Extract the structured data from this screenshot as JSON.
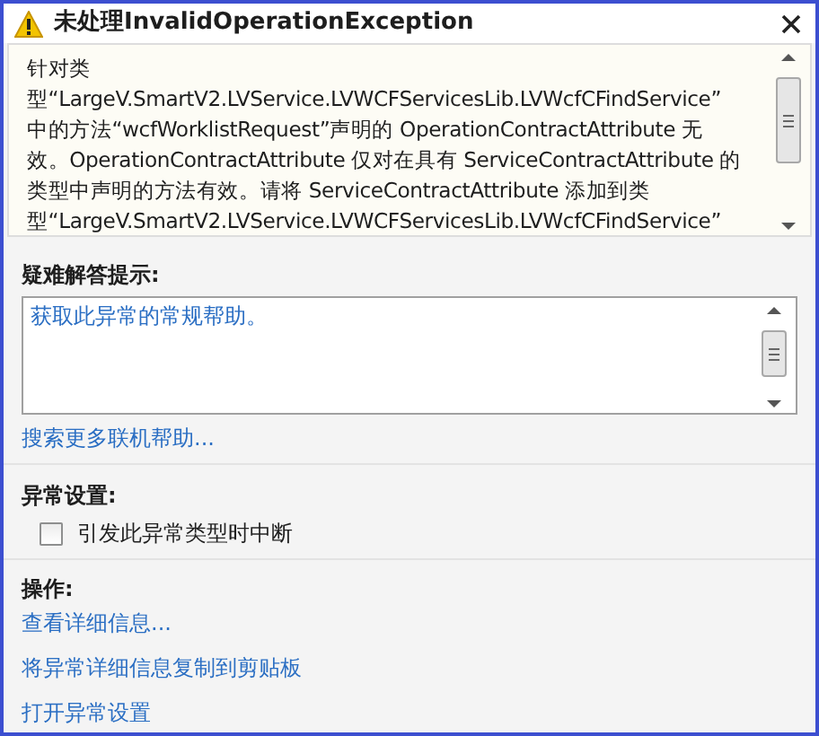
{
  "window": {
    "title": "未处理InvalidOperationException"
  },
  "message_lines": [
    "针对类",
    "型“LargeV.SmartV2.LVService.LVWCFServicesLib.LVWcfCFindService”",
    "中的方法“wcfWorklistRequest”声明的 OperationContractAttribute 无",
    "效。OperationContractAttribute 仅对在具有 ServiceContractAttribute 的",
    "类型中声明的方法有效。请将 ServiceContractAttribute 添加到类",
    "型“LargeV.SmartV2.LVService.LVWCFServicesLib.LVWcfCFindService”"
  ],
  "troubleshooting": {
    "heading": "疑难解答提示:",
    "tips": [
      "获取此异常的常规帮助。"
    ],
    "search_link": "搜索更多联机帮助..."
  },
  "exception_settings": {
    "heading": "异常设置:",
    "checkbox": {
      "label": "引发此异常类型时中断",
      "checked": false
    }
  },
  "actions": {
    "heading": "操作:",
    "links": [
      "查看详细信息...",
      "将异常详细信息复制到剪贴板",
      "打开异常设置"
    ]
  }
}
